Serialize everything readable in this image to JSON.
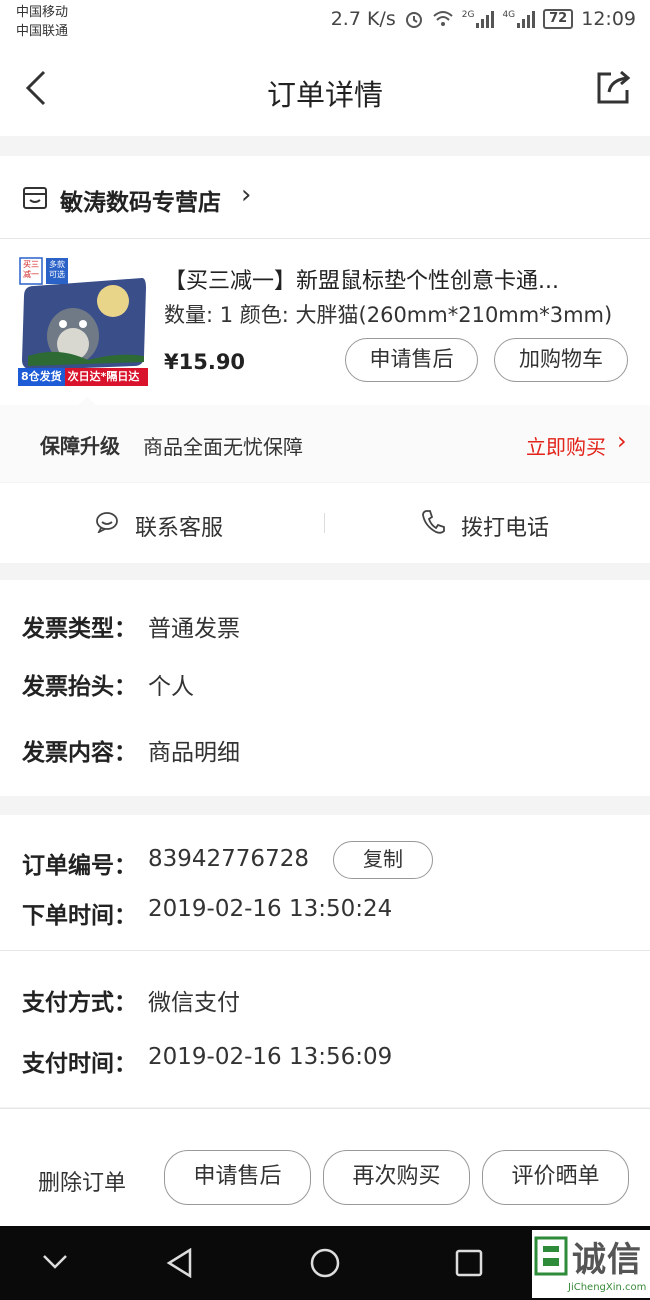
{
  "status_bar": {
    "carrier1": "中国移动",
    "carrier2": "中国联通",
    "speed": "2.7 K/s",
    "net1": "2G",
    "net2": "4G",
    "battery": "72",
    "time": "12:09"
  },
  "header": {
    "title": "订单详情"
  },
  "shop": {
    "name": "敏涛数码专营店",
    "chevron": "›"
  },
  "product": {
    "thumb_tag1": "买三减一",
    "thumb_tag2": "多款可选",
    "thumb_ship": "8仓发货",
    "thumb_fast": "次日达*隔日达",
    "name": "【买三减一】新盟鼠标垫个性创意卡通...",
    "spec": "数量: 1  颜色: 大胖猫(260mm*210mm*3mm)",
    "price": "¥15.90",
    "btn_after_sale": "申请售后",
    "btn_add_cart": "加购物车"
  },
  "guarantee": {
    "title": "保障升级",
    "desc": "商品全面无忧保障",
    "action": "立即购买",
    "chevron": "›"
  },
  "contact": {
    "service": "联系客服",
    "phone": "拨打电话"
  },
  "invoice": {
    "type_label": "发票类型：",
    "type_value": "普通发票",
    "title_label": "发票抬头：",
    "title_value": "个人",
    "content_label": "发票内容：",
    "content_value": "商品明细"
  },
  "order": {
    "no_label": "订单编号：",
    "no_value": "83942776728",
    "copy": "复制",
    "time_label": "下单时间：",
    "time_value": "2019-02-16 13:50:24",
    "pay_label": "支付方式：",
    "pay_value": "微信支付",
    "paytime_label": "支付时间：",
    "paytime_value": "2019-02-16 13:56:09"
  },
  "actions": {
    "delete": "删除订单",
    "after_sale": "申请售后",
    "rebuy": "再次购买",
    "review": "评价晒单"
  },
  "watermark": {
    "brand": "诚信",
    "url": "JiChengXin.com"
  },
  "colors": {
    "accent": "#e2231a",
    "background": "#f4f4f4"
  }
}
